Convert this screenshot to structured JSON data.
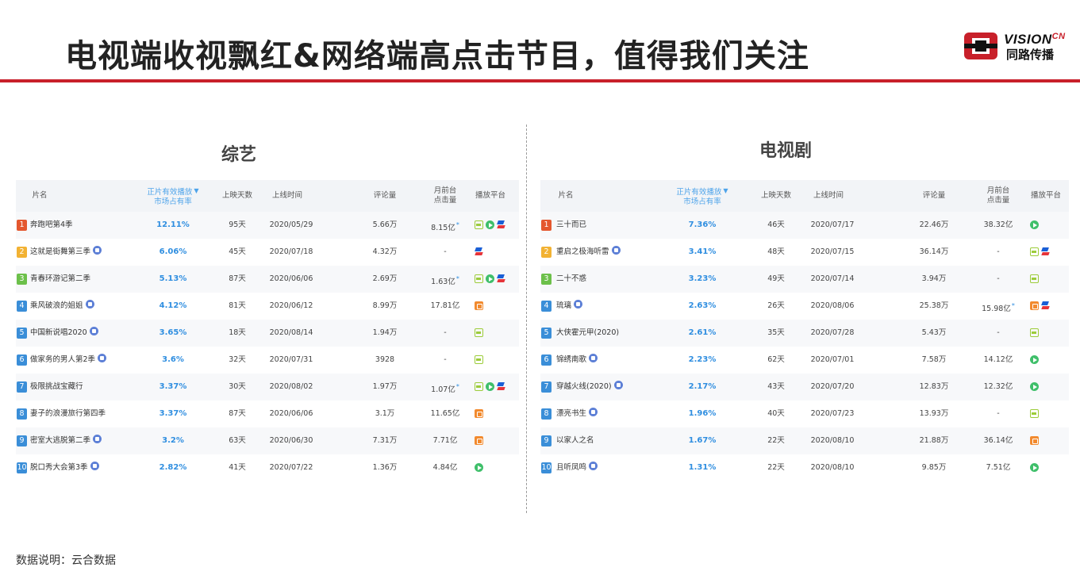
{
  "header": {
    "title": "电视端收视飘红&网络端高点击节目，值得我们关注",
    "logo_text": "VISION",
    "logo_cn": "CN",
    "logo_sub": "同路传播"
  },
  "colors": {
    "accent_red": "#c8202a",
    "share_blue": "#2f8ee0"
  },
  "variety": {
    "title": "综艺",
    "columns": {
      "name": "片名",
      "share_1": "正片有效播放",
      "share_2": "市场占有率",
      "days": "上映天数",
      "date": "上线时间",
      "comments": "评论量",
      "clicks_1": "月前台",
      "clicks_2": "点击量",
      "platform": "播放平台"
    },
    "rows": [
      {
        "rank": "1",
        "name": "奔跑吧第4季",
        "badge": false,
        "share": "12.11%",
        "days": "95天",
        "date": "2020/05/29",
        "comments": "5.66万",
        "clicks": "8.15亿",
        "star": true,
        "platforms": [
          "iqiyi-icon",
          "tencent-video-icon",
          "youku-icon"
        ]
      },
      {
        "rank": "2",
        "name": "这就是街舞第三季",
        "badge": true,
        "share": "6.06%",
        "days": "45天",
        "date": "2020/07/18",
        "comments": "4.32万",
        "clicks": "-",
        "star": false,
        "platforms": [
          "youku-icon"
        ]
      },
      {
        "rank": "3",
        "name": "青春环游记第二季",
        "badge": false,
        "share": "5.13%",
        "days": "87天",
        "date": "2020/06/06",
        "comments": "2.69万",
        "clicks": "1.63亿",
        "star": true,
        "platforms": [
          "iqiyi-icon",
          "tencent-video-icon",
          "youku-icon"
        ]
      },
      {
        "rank": "4",
        "name": "乘风破浪的姐姐",
        "badge": true,
        "share": "4.12%",
        "days": "81天",
        "date": "2020/06/12",
        "comments": "8.99万",
        "clicks": "17.81亿",
        "star": false,
        "platforms": [
          "mango-tv-icon"
        ]
      },
      {
        "rank": "5",
        "name": "中国新说唱2020",
        "badge": true,
        "share": "3.65%",
        "days": "18天",
        "date": "2020/08/14",
        "comments": "1.94万",
        "clicks": "-",
        "star": false,
        "platforms": [
          "iqiyi-icon"
        ]
      },
      {
        "rank": "6",
        "name": "做家务的男人第2季",
        "badge": true,
        "share": "3.6%",
        "days": "32天",
        "date": "2020/07/31",
        "comments": "3928",
        "clicks": "-",
        "star": false,
        "platforms": [
          "iqiyi-icon"
        ]
      },
      {
        "rank": "7",
        "name": "极限挑战宝藏行",
        "badge": false,
        "share": "3.37%",
        "days": "30天",
        "date": "2020/08/02",
        "comments": "1.97万",
        "clicks": "1.07亿",
        "star": true,
        "platforms": [
          "iqiyi-icon",
          "tencent-video-icon",
          "youku-icon"
        ]
      },
      {
        "rank": "8",
        "name": "妻子的浪漫旅行第四季",
        "badge": false,
        "share": "3.37%",
        "days": "87天",
        "date": "2020/06/06",
        "comments": "3.1万",
        "clicks": "11.65亿",
        "star": false,
        "platforms": [
          "mango-tv-icon"
        ]
      },
      {
        "rank": "9",
        "name": "密室大逃脱第二季",
        "badge": true,
        "share": "3.2%",
        "days": "63天",
        "date": "2020/06/30",
        "comments": "7.31万",
        "clicks": "7.71亿",
        "star": false,
        "platforms": [
          "mango-tv-icon"
        ]
      },
      {
        "rank": "10",
        "name": "脱口秀大会第3季",
        "badge": true,
        "share": "2.82%",
        "days": "41天",
        "date": "2020/07/22",
        "comments": "1.36万",
        "clicks": "4.84亿",
        "star": false,
        "platforms": [
          "tencent-video-icon"
        ]
      }
    ]
  },
  "drama": {
    "title": "电视剧",
    "columns": {
      "name": "片名",
      "share_1": "正片有效播放",
      "share_2": "市场占有率",
      "days": "上映天数",
      "date": "上线时间",
      "comments": "评论量",
      "clicks_1": "月前台",
      "clicks_2": "点击量",
      "platform": "播放平台"
    },
    "rows": [
      {
        "rank": "1",
        "name": "三十而已",
        "badge": false,
        "share": "7.36%",
        "days": "46天",
        "date": "2020/07/17",
        "comments": "22.46万",
        "clicks": "38.32亿",
        "star": false,
        "platforms": [
          "tencent-video-icon"
        ]
      },
      {
        "rank": "2",
        "name": "重启之极海听雷",
        "badge": true,
        "share": "3.41%",
        "days": "48天",
        "date": "2020/07/15",
        "comments": "36.14万",
        "clicks": "-",
        "star": false,
        "platforms": [
          "iqiyi-icon",
          "youku-icon"
        ]
      },
      {
        "rank": "3",
        "name": "二十不惑",
        "badge": false,
        "share": "3.23%",
        "days": "49天",
        "date": "2020/07/14",
        "comments": "3.94万",
        "clicks": "-",
        "star": false,
        "platforms": [
          "iqiyi-icon"
        ]
      },
      {
        "rank": "4",
        "name": "琉璃",
        "badge": true,
        "share": "2.63%",
        "days": "26天",
        "date": "2020/08/06",
        "comments": "25.38万",
        "clicks": "15.98亿",
        "star": true,
        "platforms": [
          "mango-tv-icon",
          "youku-icon"
        ]
      },
      {
        "rank": "5",
        "name": "大侠霍元甲(2020)",
        "badge": false,
        "share": "2.61%",
        "days": "35天",
        "date": "2020/07/28",
        "comments": "5.43万",
        "clicks": "-",
        "star": false,
        "platforms": [
          "iqiyi-icon"
        ]
      },
      {
        "rank": "6",
        "name": "锦绣南歌",
        "badge": true,
        "share": "2.23%",
        "days": "62天",
        "date": "2020/07/01",
        "comments": "7.58万",
        "clicks": "14.12亿",
        "star": false,
        "platforms": [
          "tencent-video-icon"
        ]
      },
      {
        "rank": "7",
        "name": "穿越火线(2020)",
        "badge": true,
        "share": "2.17%",
        "days": "43天",
        "date": "2020/07/20",
        "comments": "12.83万",
        "clicks": "12.32亿",
        "star": false,
        "platforms": [
          "tencent-video-icon"
        ]
      },
      {
        "rank": "8",
        "name": "漂亮书生",
        "badge": true,
        "share": "1.96%",
        "days": "40天",
        "date": "2020/07/23",
        "comments": "13.93万",
        "clicks": "-",
        "star": false,
        "platforms": [
          "iqiyi-icon"
        ]
      },
      {
        "rank": "9",
        "name": "以家人之名",
        "badge": false,
        "share": "1.67%",
        "days": "22天",
        "date": "2020/08/10",
        "comments": "21.88万",
        "clicks": "36.14亿",
        "star": false,
        "platforms": [
          "mango-tv-icon"
        ]
      },
      {
        "rank": "10",
        "name": "且听凤鸣",
        "badge": true,
        "share": "1.31%",
        "days": "22天",
        "date": "2020/08/10",
        "comments": "9.85万",
        "clicks": "7.51亿",
        "star": false,
        "platforms": [
          "tencent-video-icon"
        ]
      }
    ]
  },
  "rank_colors": [
    "#e4572e",
    "#f2b233",
    "#6cc04a",
    "#3a8ed8",
    "#3a8ed8",
    "#3a8ed8",
    "#3a8ed8",
    "#3a8ed8",
    "#3a8ed8",
    "#3a8ed8"
  ],
  "footnote": "数据说明：云合数据"
}
